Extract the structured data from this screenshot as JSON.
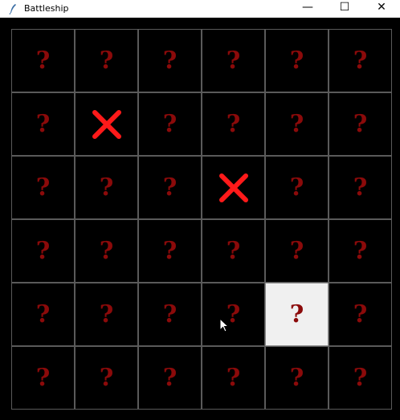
{
  "window": {
    "title": "Battleship",
    "controls": {
      "minimize": "—",
      "maximize": "☐",
      "close": "✕"
    }
  },
  "board": {
    "rows": 6,
    "cols": 6,
    "hidden_symbol": "?",
    "colors": {
      "question_mark": "#8b0a0a",
      "hit_mark": "#ff1a1a",
      "selected_cell": "#f0f0f0",
      "cell_background": "#000000",
      "grid_line": "#5a5a5a"
    },
    "cells": [
      [
        "unknown",
        "unknown",
        "unknown",
        "unknown",
        "unknown",
        "unknown"
      ],
      [
        "unknown",
        "hit",
        "unknown",
        "unknown",
        "unknown",
        "unknown"
      ],
      [
        "unknown",
        "unknown",
        "unknown",
        "hit",
        "unknown",
        "unknown"
      ],
      [
        "unknown",
        "unknown",
        "unknown",
        "unknown",
        "unknown",
        "unknown"
      ],
      [
        "unknown",
        "unknown",
        "unknown",
        "unknown",
        "selected",
        "unknown"
      ],
      [
        "unknown",
        "unknown",
        "unknown",
        "unknown",
        "unknown",
        "unknown"
      ]
    ]
  }
}
